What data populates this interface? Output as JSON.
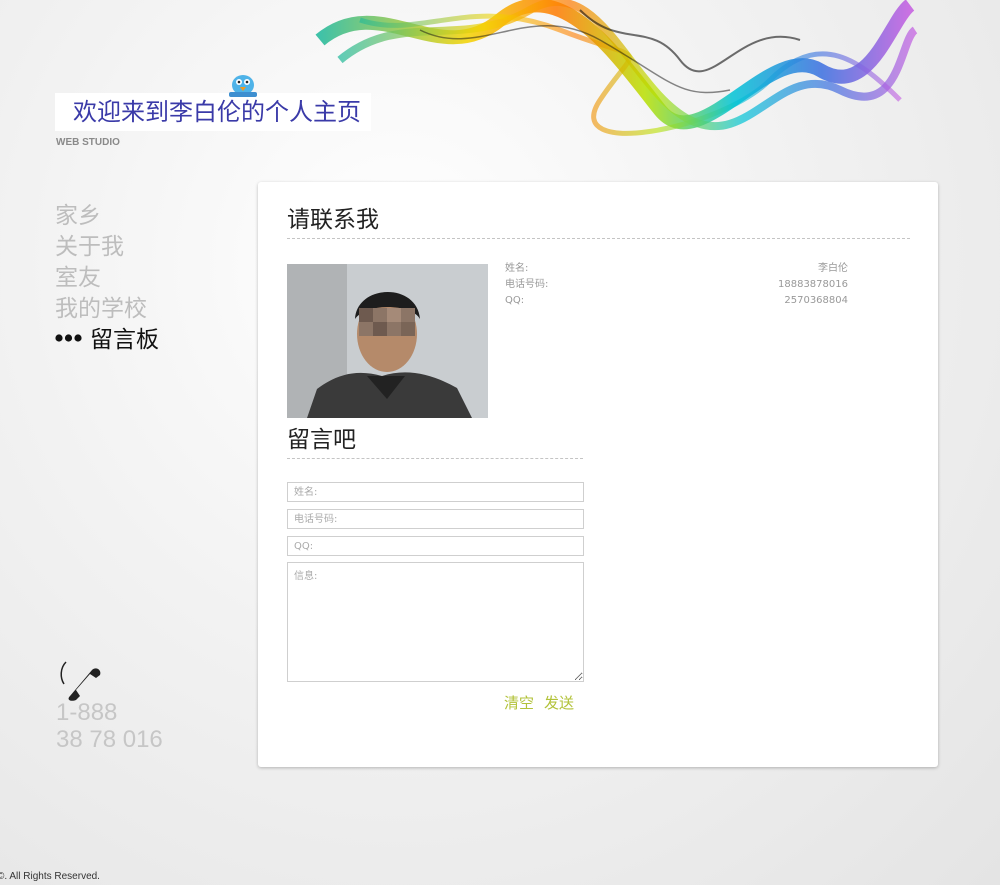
{
  "header": {
    "title": "欢迎来到李白伦的个人主页",
    "subtitle": "WEB STUDIO"
  },
  "nav": {
    "items": [
      {
        "label": "家乡"
      },
      {
        "label": "关于我"
      },
      {
        "label": "室友"
      },
      {
        "label": "我的学校"
      },
      {
        "label": "留言板",
        "active": true
      }
    ]
  },
  "phone": {
    "line1": "1-888",
    "line2": "38 78 016"
  },
  "contact": {
    "heading": "请联系我",
    "rows": [
      {
        "label": "姓名:",
        "value": "李白伦"
      },
      {
        "label": "电话号码:",
        "value": "18883878016"
      },
      {
        "label": "QQ:",
        "value": "2570368804"
      }
    ]
  },
  "message": {
    "heading": "留言吧",
    "name_placeholder": "姓名:",
    "phone_placeholder": "电话号码:",
    "qq_placeholder": "QQ:",
    "msg_placeholder": "信息:",
    "clear_label": "清空",
    "send_label": "发送"
  },
  "footer": {
    "text": "©. All Rights Reserved."
  },
  "colors": {
    "title": "#3a3aa8",
    "nav_inactive": "#bdbdbd",
    "nav_active": "#111111",
    "button_text": "#b2c238"
  }
}
